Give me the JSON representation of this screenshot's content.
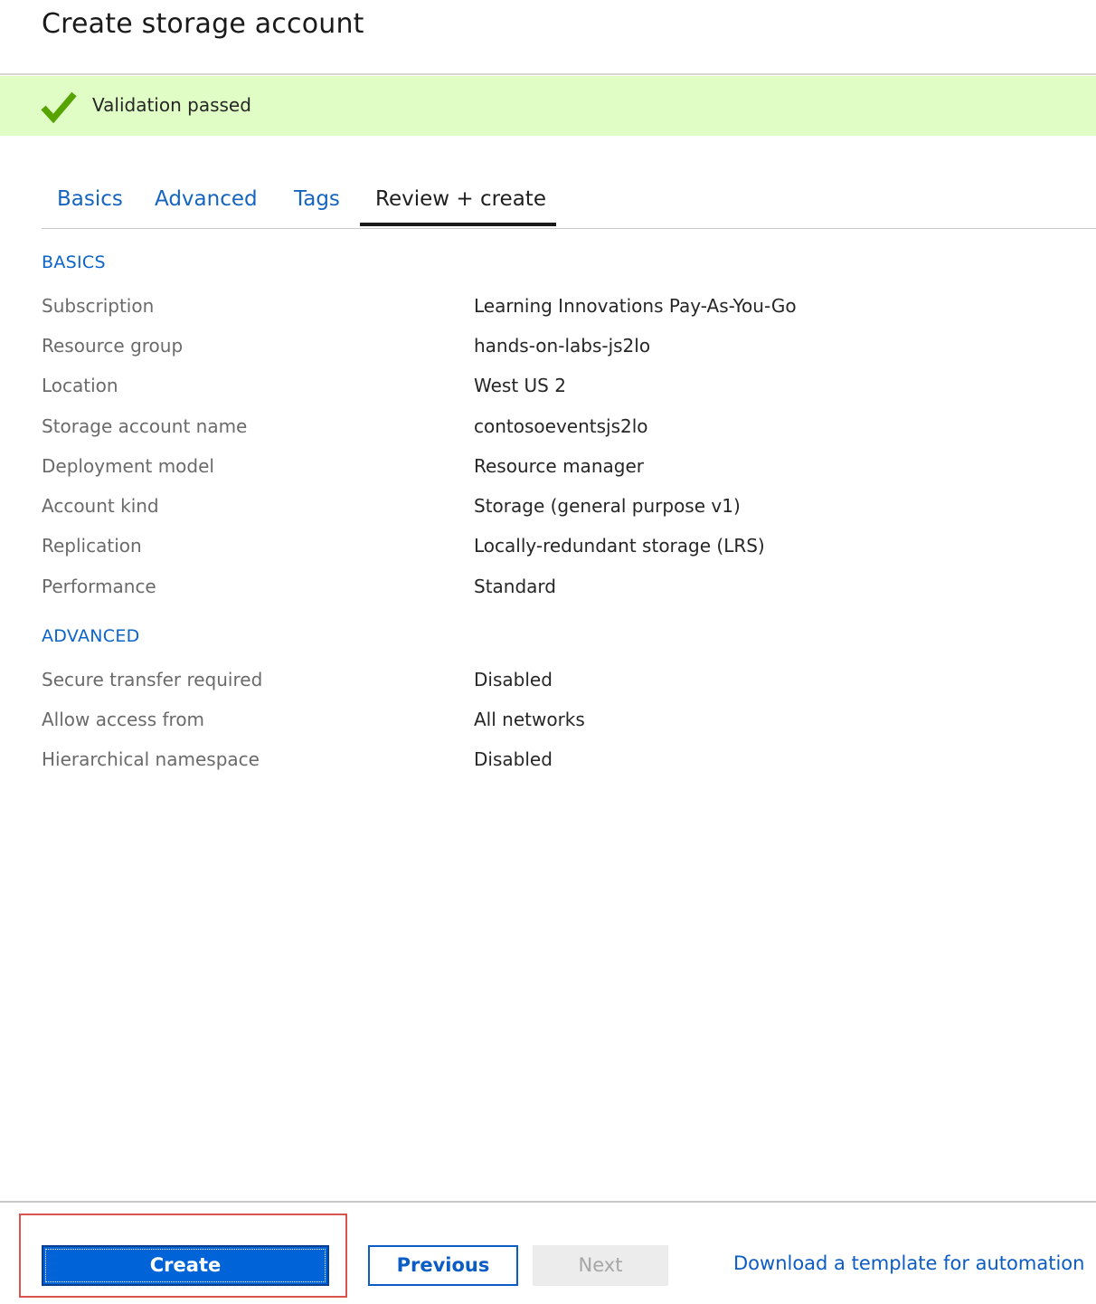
{
  "header": {
    "title": "Create storage account"
  },
  "banner": {
    "status_icon": "checkmark-icon",
    "text": "Validation passed",
    "background_color": "#e0fdc6",
    "icon_color": "#57a300"
  },
  "tabs": [
    {
      "label": "Basics",
      "active": false
    },
    {
      "label": "Advanced",
      "active": false
    },
    {
      "label": "Tags",
      "active": false
    },
    {
      "label": "Review + create",
      "active": true
    }
  ],
  "sections": {
    "basics": {
      "heading": "BASICS",
      "rows": [
        {
          "label": "Subscription",
          "value": "Learning Innovations Pay-As-You-Go"
        },
        {
          "label": "Resource group",
          "value": "hands-on-labs-js2lo"
        },
        {
          "label": "Location",
          "value": "West US 2"
        },
        {
          "label": "Storage account name",
          "value": "contosoeventsjs2lo"
        },
        {
          "label": "Deployment model",
          "value": "Resource manager"
        },
        {
          "label": "Account kind",
          "value": "Storage (general purpose v1)"
        },
        {
          "label": "Replication",
          "value": "Locally-redundant storage (LRS)"
        },
        {
          "label": "Performance",
          "value": "Standard"
        }
      ]
    },
    "advanced": {
      "heading": "ADVANCED",
      "rows": [
        {
          "label": "Secure transfer required",
          "value": "Disabled"
        },
        {
          "label": "Allow access from",
          "value": "All networks"
        },
        {
          "label": "Hierarchical namespace",
          "value": "Disabled"
        }
      ]
    }
  },
  "footer": {
    "create_label": "Create",
    "previous_label": "Previous",
    "next_label": "Next",
    "next_disabled": true,
    "download_link": "Download a template for automation",
    "accent_color": "#0063d8",
    "highlight_color": "#d9534f"
  }
}
